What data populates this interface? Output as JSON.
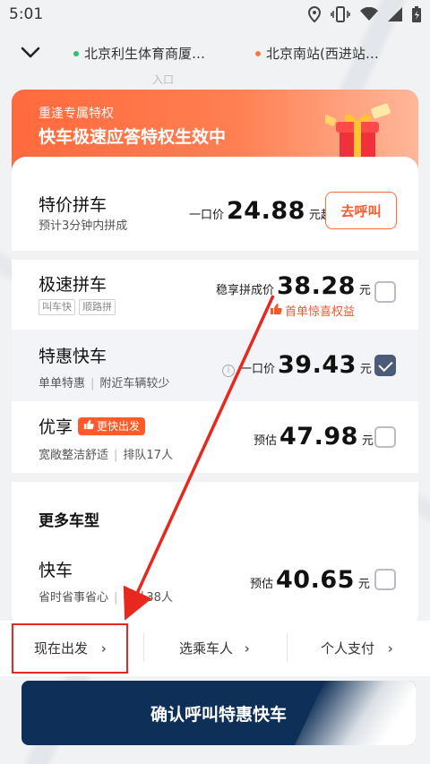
{
  "status_bar": {
    "time": "5:01"
  },
  "map": {
    "labels": [
      "入口",
      "入口"
    ]
  },
  "route": {
    "origin": "北京利生体育商厦…",
    "destination": "北京南站(西进站…",
    "origin_color": "#2fbf71",
    "destination_color": "#ff7a45"
  },
  "banner": {
    "subtitle": "重逢专属特权",
    "title": "快车极速应答特权生效中"
  },
  "featured": {
    "title": "特价拼车",
    "desc": "预计3分钟内拼成",
    "price_prefix": "一口价",
    "price": "24.88",
    "price_unit": "元起",
    "button": "去呼叫"
  },
  "options": [
    {
      "title": "极速拼车",
      "tags": [
        "叫车快",
        "顺路拼"
      ],
      "price_prefix": "稳享拼成价",
      "price": "38.28",
      "price_unit": "元",
      "promo": "首单惊喜权益",
      "checked": false
    },
    {
      "title": "特惠快车",
      "desc": [
        "单单特惠",
        "附近车辆较少"
      ],
      "price_prefix": "一口价",
      "price": "39.43",
      "price_unit": "元",
      "checked": true
    },
    {
      "title": "优享",
      "badge": "更快出发",
      "desc": [
        "宽敞整洁舒适",
        "排队17人"
      ],
      "price_prefix": "预估",
      "price": "47.98",
      "price_unit": "元",
      "checked": false
    }
  ],
  "more": {
    "title": "更多车型",
    "items": [
      {
        "title": "快车",
        "desc": [
          "省时省事省心",
          "排队38人"
        ],
        "price_prefix": "预估",
        "price": "40.65",
        "price_unit": "元",
        "checked": false
      }
    ]
  },
  "bottom_options": {
    "depart": "现在出发",
    "passenger": "选乘车人",
    "payment": "个人支付"
  },
  "confirm_button": "确认呼叫特惠快车",
  "colors": {
    "accent": "#ff5a2a",
    "navy": "#0e2f57",
    "annotation_red": "#e8271e"
  }
}
